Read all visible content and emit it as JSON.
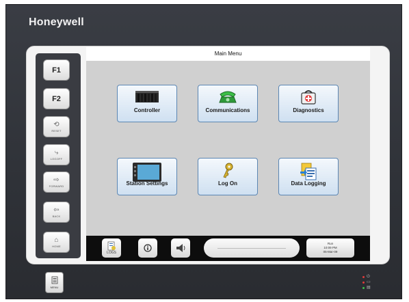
{
  "brand": {
    "name": "Honeywell"
  },
  "screen": {
    "title": "Main Menu"
  },
  "function_keys": [
    {
      "label": "F1",
      "sub": ""
    },
    {
      "label": "F2",
      "sub": ""
    },
    {
      "label": "",
      "sub": "RESET",
      "icon": "reset-icon"
    },
    {
      "label": "",
      "sub": "LOGOFF",
      "icon": "logoff-icon"
    },
    {
      "label": "",
      "sub": "FORWARD",
      "icon": "forward-arrow-icon"
    },
    {
      "label": "",
      "sub": "BACK",
      "icon": "back-arrow-icon"
    },
    {
      "label": "",
      "sub": "HOME",
      "icon": "home-icon"
    }
  ],
  "menu_tiles": [
    {
      "label": "Controller",
      "icon": "controller-rack-icon"
    },
    {
      "label": "Communications",
      "icon": "telephone-icon"
    },
    {
      "label": "Diagnostics",
      "icon": "first-aid-kit-icon"
    },
    {
      "label": "Station Settings",
      "icon": "monitor-icon"
    },
    {
      "label": "Log On",
      "icon": "key-icon"
    },
    {
      "label": "Data Logging",
      "icon": "data-logging-icon"
    }
  ],
  "bottom_bar": {
    "buttons": [
      {
        "label": "LOGS",
        "icon": "logs-icon"
      },
      {
        "label": "",
        "icon": "info-icon"
      },
      {
        "label": "",
        "icon": "alarm-horn-icon"
      }
    ],
    "status_text": "",
    "clock": {
      "line1": "Run",
      "line2": "10:09 PM",
      "line3": "05-Mar-09"
    }
  },
  "menu_key": {
    "sub": "MENU"
  },
  "colors": {
    "bezel": "#2f3238",
    "tile_border": "#5b86b3",
    "tile_fill": "#cfe0f1",
    "led_red": "#e23a3a",
    "led_green": "#3dc24a"
  }
}
